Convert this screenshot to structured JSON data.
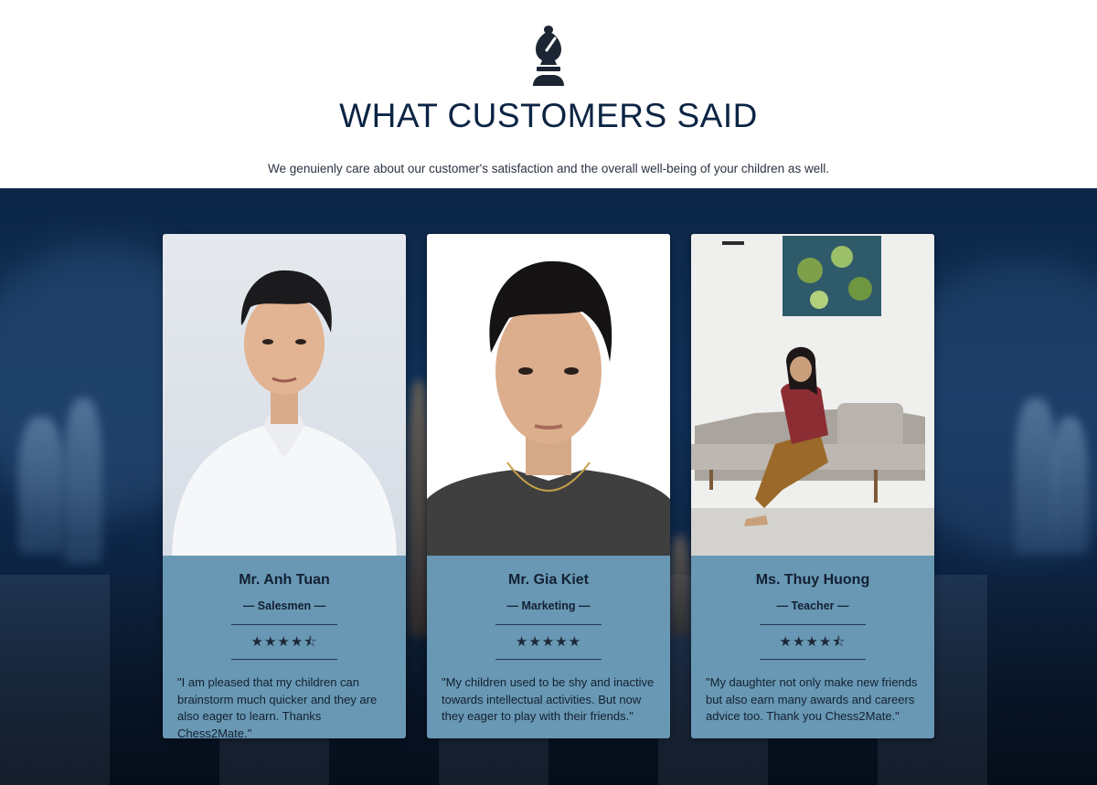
{
  "header": {
    "logo_icon": "chess-bishop-icon",
    "title": "WHAT CUSTOMERS SAID",
    "subtitle": "We genuienly care about our customer's satisfaction and the overall well-being of your children as well."
  },
  "colors": {
    "title": "#0c2444",
    "card_bg": "#6898b4",
    "band_bg": "#0c2747"
  },
  "testimonials": [
    {
      "name": "Mr. Anh Tuan",
      "role": "— Salesmen —",
      "rating": 4.5,
      "stars": "★★★★⯪",
      "quote": "\"I am pleased that my children can brainstorm much quicker and they are also eager to learn. Thanks Chess2Mate.\""
    },
    {
      "name": "Mr. Gia Kiet",
      "role": "— Marketing —",
      "rating": 5,
      "stars": "★★★★★",
      "quote": "\"My children used to be shy and inactive towards intellectual activities. But now they eager to play with their friends.\""
    },
    {
      "name": "Ms. Thuy Huong",
      "role": "— Teacher —",
      "rating": 4.5,
      "stars": "★★★★⯪",
      "quote": "\"My daughter not only make new friends but also earn many awards and careers advice too. Thank you Chess2Mate.\""
    }
  ]
}
